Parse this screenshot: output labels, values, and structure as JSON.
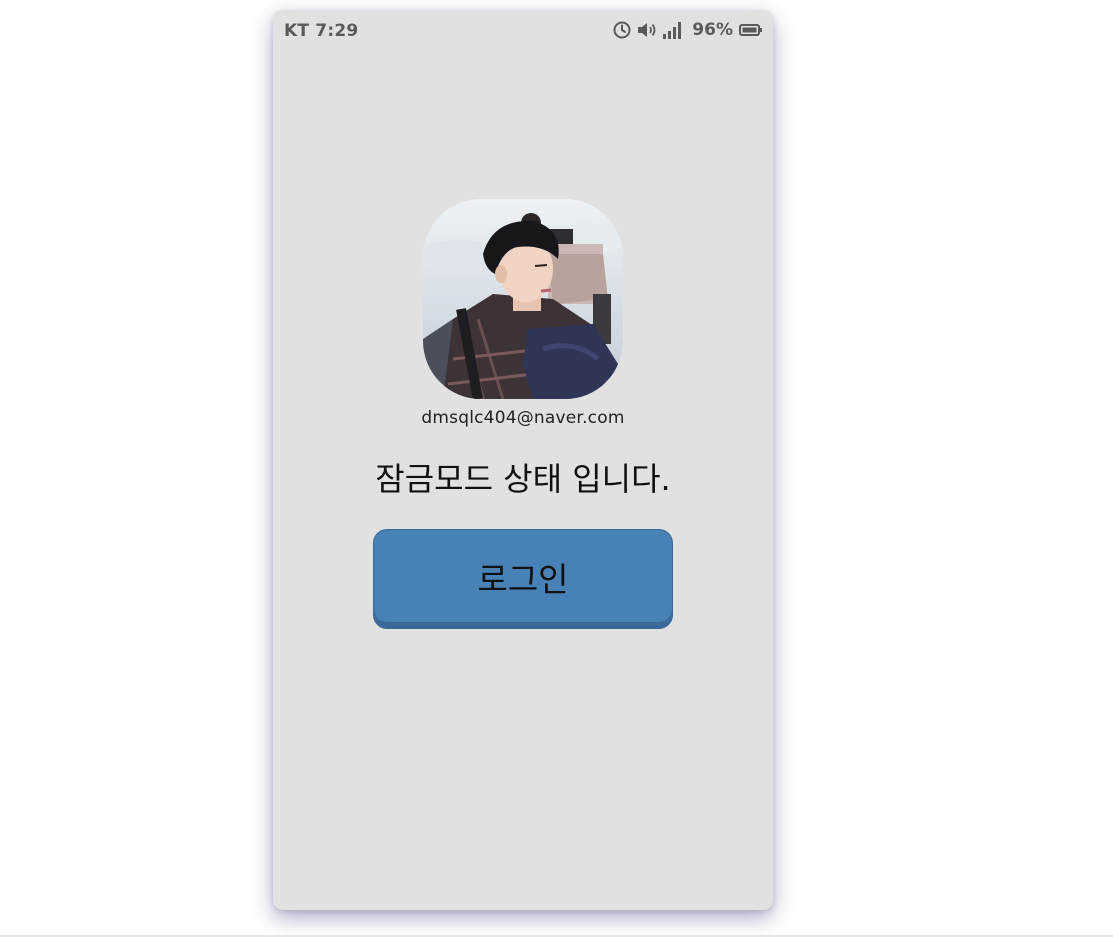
{
  "status_bar": {
    "carrier_time": "KT 7:29",
    "battery_percent": "96%",
    "icons": [
      "alarm-clock-icon",
      "volume-icon",
      "signal-icon",
      "battery-icon"
    ]
  },
  "profile": {
    "avatar": "profile-photo",
    "email": "dmsqlc404@naver.com"
  },
  "lock_screen": {
    "message": "잠금모드 상태 입니다.",
    "login_label": "로그인"
  },
  "colors": {
    "phone_background": "#e1e1e2",
    "button_background": "#4781b6",
    "page_background": "#ffffff"
  }
}
